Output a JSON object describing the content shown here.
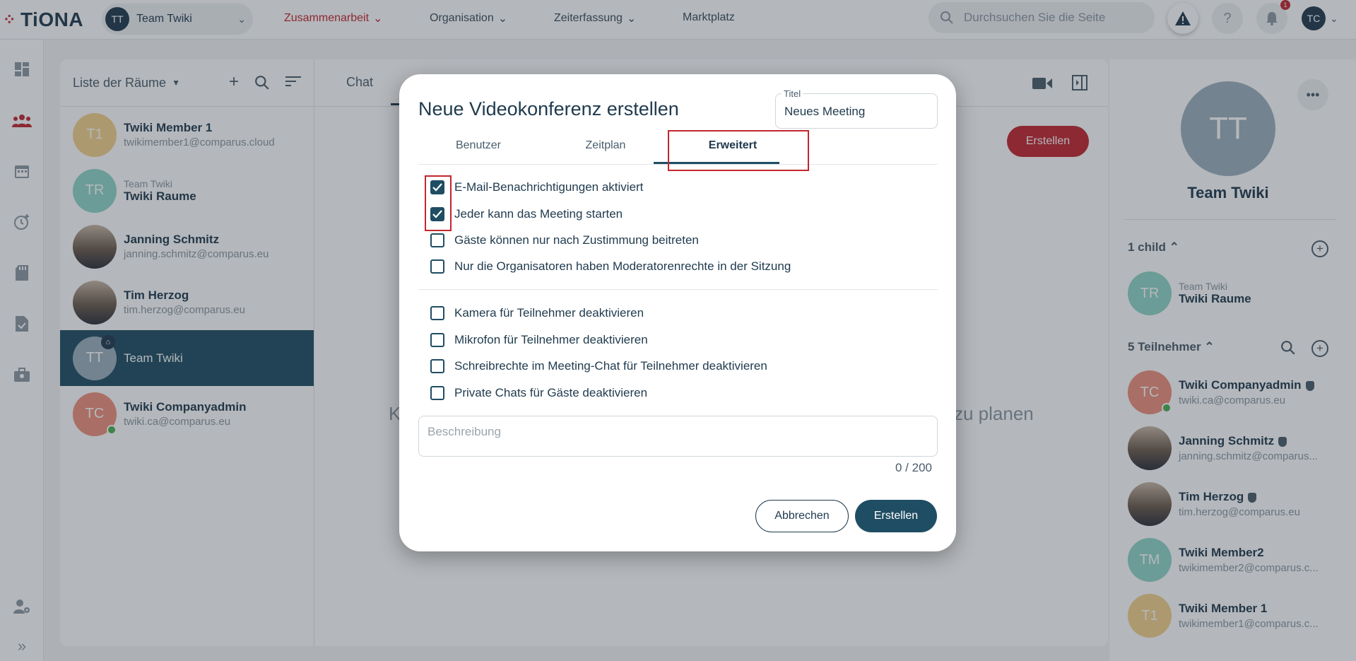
{
  "app": {
    "logo": "TiONA"
  },
  "header": {
    "team_select": {
      "initials": "TT",
      "label": "Team Twiki"
    },
    "nav": [
      {
        "label": "Zusammenarbeit",
        "active": true
      },
      {
        "label": "Organisation",
        "active": false
      },
      {
        "label": "Zeiterfassung",
        "active": false
      },
      {
        "label": "Marktplatz",
        "active": false
      }
    ],
    "search": {
      "placeholder": "Durchsuchen Sie die Seite"
    },
    "notification_count": "1",
    "user_initials": "TC"
  },
  "rooms": {
    "title": "Liste der Räume",
    "items": [
      {
        "initials": "T1",
        "pre": "",
        "name": "Twiki Member 1",
        "sub": "twikimember1@comparus.cloud",
        "color": "#f3d28b"
      },
      {
        "initials": "TR",
        "pre": "Team Twiki",
        "name": "Twiki Raume",
        "sub": "",
        "color": "#8fd6c8"
      },
      {
        "initials": "",
        "pre": "",
        "name": "Janning Schmitz",
        "sub": "janning.schmitz@comparus.eu",
        "color": ""
      },
      {
        "initials": "",
        "pre": "",
        "name": "Tim Herzog",
        "sub": "tim.herzog@comparus.eu",
        "color": ""
      },
      {
        "initials": "TT",
        "pre": "",
        "name": "Team Twiki",
        "sub": "",
        "color": "#9bb0bd"
      },
      {
        "initials": "TC",
        "pre": "",
        "name": "Twiki Companyadmin",
        "sub": "twiki.ca@comparus.eu",
        "color": "#ef8f7b"
      }
    ]
  },
  "chat": {
    "tab": "Chat",
    "create_label": "Erstellen",
    "bg_left": "K",
    "bg_right": "zu planen"
  },
  "right_panel": {
    "initials": "TT",
    "title": "Team Twiki",
    "children_label": "1 child",
    "child": {
      "initials": "TR",
      "pre": "Team Twiki",
      "name": "Twiki Raume"
    },
    "members_label": "5 Teilnehmer",
    "members": [
      {
        "initials": "TC",
        "name": "Twiki Companyadmin",
        "sub": "twiki.ca@comparus.eu"
      },
      {
        "initials": "",
        "name": "Janning Schmitz",
        "sub": "janning.schmitz@comparus..."
      },
      {
        "initials": "",
        "name": "Tim Herzog",
        "sub": "tim.herzog@comparus.eu"
      },
      {
        "initials": "TM",
        "name": "Twiki Member2",
        "sub": "twikimember2@comparus.c..."
      },
      {
        "initials": "T1",
        "name": "Twiki Member 1",
        "sub": "twikimember1@comparus.c..."
      }
    ]
  },
  "dialog": {
    "title": "Neue Videokonferenz erstellen",
    "title_field": {
      "label": "Titel",
      "value": "Neues Meeting"
    },
    "tabs": [
      "Benutzer",
      "Zeitplan",
      "Erweitert"
    ],
    "active_tab": "Erweitert",
    "options": [
      {
        "label": "E-Mail-Benachrichtigungen aktiviert",
        "checked": true
      },
      {
        "label": "Jeder kann das Meeting starten",
        "checked": true
      },
      {
        "label": "Gäste können nur nach Zustimmung beitreten",
        "checked": false
      },
      {
        "label": "Nur die Organisatoren haben Moderatorenrechte in der Sitzung",
        "checked": false
      },
      {
        "label": "Kamera für Teilnehmer deaktivieren",
        "checked": false
      },
      {
        "label": "Mikrofon für Teilnehmer deaktivieren",
        "checked": false
      },
      {
        "label": "Schreibrechte im Meeting-Chat für Teilnehmer deaktivieren",
        "checked": false
      },
      {
        "label": "Private Chats für Gäste deaktivieren",
        "checked": false
      }
    ],
    "description_placeholder": "Beschreibung",
    "counter": "0 / 200",
    "cancel_label": "Abbrechen",
    "create_label": "Erstellen"
  }
}
